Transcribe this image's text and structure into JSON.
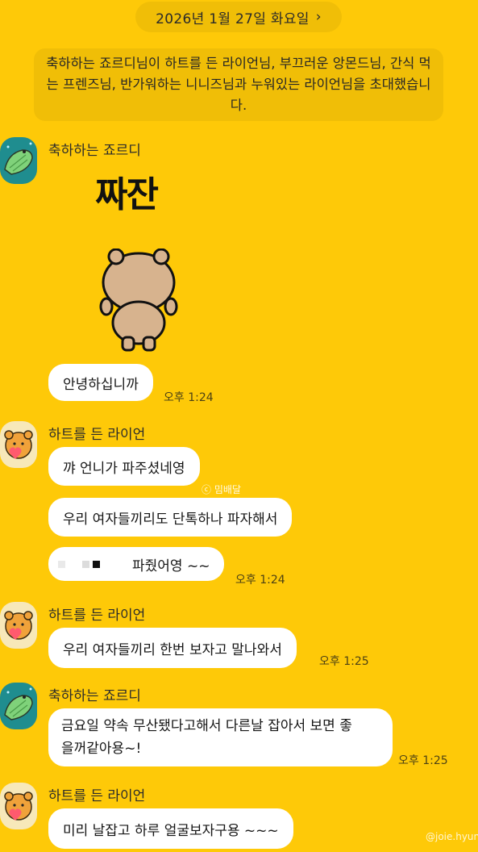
{
  "date_header": {
    "label": "2026년 1월 27일 화요일",
    "chevron": "›"
  },
  "system_message": "축하하는 죠르디님이 하트를 든 라이언님, 부끄러운 앙몬드님, 간식 먹는 프렌즈님, 반가워하는 니니즈님과 누워있는 라이언님을 초대했습니다.",
  "sticker": {
    "text": "짜잔",
    "icon": "bear-back-sticker"
  },
  "messages": [
    {
      "sender": "축하하는 죠르디",
      "avatar": "jordy-avatar-icon"
    },
    {
      "text": "안녕하십니까",
      "time": "오후 1:24"
    },
    {
      "sender": "하트를 든 라이언",
      "avatar": "ryan-avatar-icon"
    },
    {
      "text": "꺄 언니가 파주셨네영"
    },
    {
      "text": "우리 여자들끼리도 단톡하나 파자해서"
    },
    {
      "text": "파줬어영 ~~",
      "time": "오후 1:24"
    },
    {
      "sender": "하트를 든 라이언"
    },
    {
      "text": "우리 여자들끼리 한번 보자고 말나와서",
      "time": "오후 1:25"
    },
    {
      "sender": "축하하는 죠르디"
    },
    {
      "text_line1": "금요일 약속 무산됐다고해서 다른날 잡아서 보면 좋",
      "text_line2": "을꺼같아용~!",
      "time": "오후 1:25"
    },
    {
      "sender": "하트를 든 라이언"
    },
    {
      "text": "미리 날잡고 하루 얼굴보자구용 ~~~"
    }
  ],
  "watermarks": {
    "center": "ⓒ 밈배달",
    "corner": "@joie.hyun"
  }
}
